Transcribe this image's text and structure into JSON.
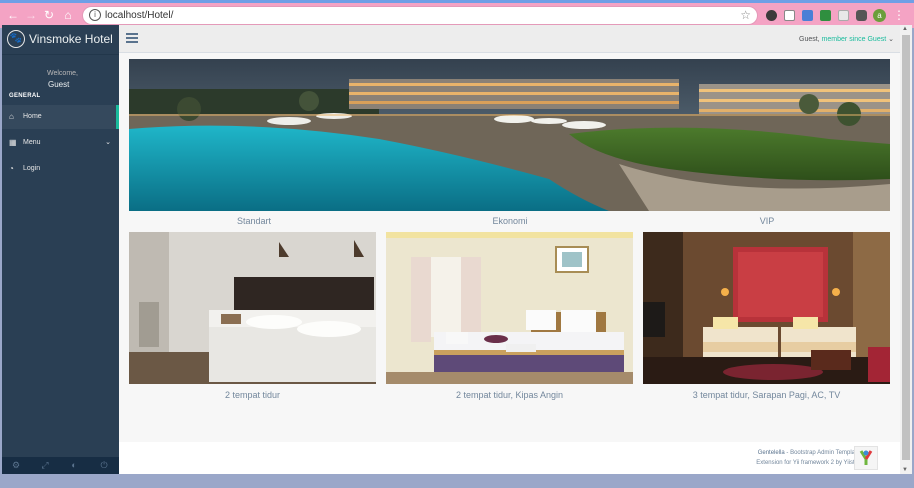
{
  "browser": {
    "url": "localhost/Hotel/",
    "profile_initial": "a"
  },
  "sidebar": {
    "brand": "Vinsmoke Hotel",
    "welcome": "Welcome,",
    "user": "Guest",
    "section": "GENERAL",
    "items": [
      {
        "label": "Home",
        "icon": "home-icon"
      },
      {
        "label": "Menu",
        "icon": "grid-icon"
      },
      {
        "label": "Login",
        "icon": "dashboard-icon"
      }
    ]
  },
  "topbar": {
    "user": "Guest,",
    "member": "member since Guest"
  },
  "content": {
    "categories": [
      "Standart",
      "Ekonomi",
      "VIP"
    ],
    "rooms": [
      {
        "caption": "2 tempat tidur"
      },
      {
        "caption": "2 tempat tidur, Kipas Angin"
      },
      {
        "caption": "3 tempat tidur, Sarapan Pagi, AC, TV"
      }
    ]
  },
  "footer": {
    "brand": "Gentelella",
    "line1": " - Bootstrap Admin Template",
    "line2": "Extension for Yii framework 2 by Yiister"
  }
}
